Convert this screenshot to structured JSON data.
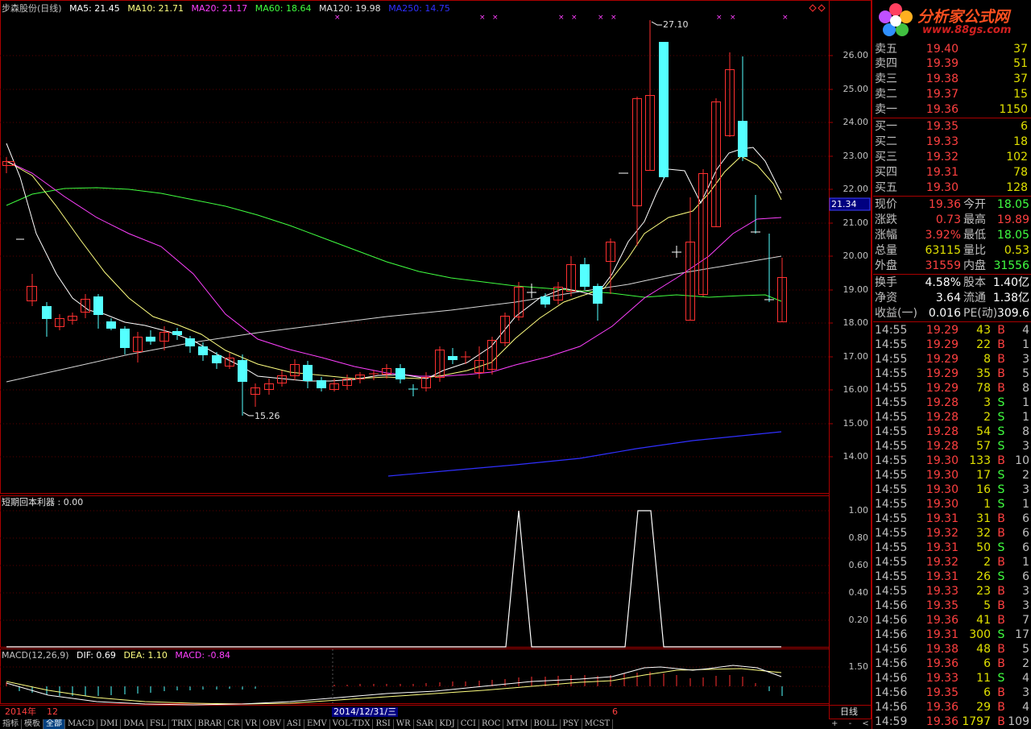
{
  "colors": {
    "up": "#ff3030",
    "down": "#54ffff",
    "ma5": "#ffffff",
    "ma10": "#ffff80",
    "ma20": "#ff40ff",
    "ma60": "#40ff40",
    "ma120": "#e0e0e0",
    "ma250": "#3030ff",
    "frame": "#aa0000"
  },
  "header": {
    "stock": "步森股份(日线)",
    "ma5": "MA5: 21.45",
    "ma10": "MA10: 21.71",
    "ma20": "MA20: 21.17",
    "ma60": "MA60: 18.64",
    "ma120": "MA120: 19.98",
    "ma250": "MA250: 14.75"
  },
  "price_axis": [
    "26.00",
    "25.00",
    "24.00",
    "23.00",
    "22.00",
    "21.00",
    "20.00",
    "19.00",
    "18.00",
    "17.00",
    "16.00",
    "15.00",
    "14.00"
  ],
  "current_price_tag": "21.34",
  "annotations": {
    "high": "27.10",
    "low": "15.26"
  },
  "indicator1": {
    "title": "短期回本利器 : 0.00",
    "axis": [
      "1.00",
      "0.80",
      "0.60",
      "0.40",
      "0.20"
    ]
  },
  "indicator2": {
    "title_a": "MACD(12,26,9)",
    "dif": "DIF: 0.69",
    "dea": "DEA: 1.10",
    "macd": "MACD: -0.84",
    "axis": [
      "1.50"
    ]
  },
  "date_axis": {
    "year": "2014年",
    "month1": "12",
    "cursor": "2014/12/31/三",
    "month2": "6",
    "period": "日线"
  },
  "toolbar": [
    "指标",
    "模板",
    "全部",
    "MACD",
    "DMI",
    "DMA",
    "FSL",
    "TRIX",
    "BRAR",
    "CR",
    "VR",
    "OBV",
    "ASI",
    "EMV",
    "VOL-TDX",
    "RSI",
    "WR",
    "SAR",
    "KDJ",
    "CCI",
    "ROC",
    "MTM",
    "BOLL",
    "PSY",
    "MCST"
  ],
  "toolbar_active": "全部",
  "scroll_btns": [
    "+",
    "-",
    "<",
    ">"
  ],
  "logo": {
    "text": "分析家公式网",
    "url": "www.88gs.com"
  },
  "sell": [
    {
      "label": "卖五",
      "price": "19.40",
      "vol": "37"
    },
    {
      "label": "卖四",
      "price": "19.39",
      "vol": "51"
    },
    {
      "label": "卖三",
      "price": "19.38",
      "vol": "37"
    },
    {
      "label": "卖二",
      "price": "19.37",
      "vol": "15"
    },
    {
      "label": "卖一",
      "price": "19.36",
      "vol": "1150"
    }
  ],
  "buy": [
    {
      "label": "买一",
      "price": "19.35",
      "vol": "6"
    },
    {
      "label": "买二",
      "price": "19.33",
      "vol": "18"
    },
    {
      "label": "买三",
      "price": "19.32",
      "vol": "102"
    },
    {
      "label": "买四",
      "price": "19.31",
      "vol": "78"
    },
    {
      "label": "买五",
      "price": "19.30",
      "vol": "128"
    }
  ],
  "quote": [
    {
      "k1": "现价",
      "v1": "19.36",
      "c1": "red",
      "k2": "今开",
      "v2": "18.05",
      "c2": "green"
    },
    {
      "k1": "涨跌",
      "v1": "0.73",
      "c1": "red",
      "k2": "最高",
      "v2": "19.89",
      "c2": "red"
    },
    {
      "k1": "涨幅",
      "v1": "3.92%",
      "c1": "red",
      "k2": "最低",
      "v2": "18.05",
      "c2": "green"
    },
    {
      "k1": "总量",
      "v1": "63115",
      "c1": "yellow",
      "k2": "量比",
      "v2": "0.53",
      "c2": "yellow"
    },
    {
      "k1": "外盘",
      "v1": "31559",
      "c1": "red",
      "k2": "内盘",
      "v2": "31556",
      "c2": "green"
    }
  ],
  "fund": [
    {
      "k1": "换手",
      "v1": "4.58%",
      "k2": "股本",
      "v2": "1.40亿"
    },
    {
      "k1": "净资",
      "v1": "3.64",
      "k2": "流通",
      "v2": "1.38亿"
    },
    {
      "k1": "收益(一)",
      "v1": "0.016",
      "k2": "PE(动)",
      "v2": "309.6"
    }
  ],
  "ticks": [
    {
      "t": "14:55",
      "p": "19.29",
      "v": "43",
      "d": "B",
      "n": "4"
    },
    {
      "t": "14:55",
      "p": "19.29",
      "v": "22",
      "d": "B",
      "n": "1"
    },
    {
      "t": "14:55",
      "p": "19.29",
      "v": "8",
      "d": "B",
      "n": "3"
    },
    {
      "t": "14:55",
      "p": "19.29",
      "v": "35",
      "d": "B",
      "n": "5"
    },
    {
      "t": "14:55",
      "p": "19.29",
      "v": "78",
      "d": "B",
      "n": "8"
    },
    {
      "t": "14:55",
      "p": "19.28",
      "v": "3",
      "d": "S",
      "n": "1"
    },
    {
      "t": "14:55",
      "p": "19.28",
      "v": "2",
      "d": "S",
      "n": "1"
    },
    {
      "t": "14:55",
      "p": "19.28",
      "v": "54",
      "d": "S",
      "n": "8"
    },
    {
      "t": "14:55",
      "p": "19.28",
      "v": "57",
      "d": "S",
      "n": "3"
    },
    {
      "t": "14:55",
      "p": "19.30",
      "v": "133",
      "d": "B",
      "n": "10"
    },
    {
      "t": "14:55",
      "p": "19.30",
      "v": "17",
      "d": "S",
      "n": "2"
    },
    {
      "t": "14:55",
      "p": "19.30",
      "v": "16",
      "d": "S",
      "n": "3"
    },
    {
      "t": "14:55",
      "p": "19.30",
      "v": "1",
      "d": "S",
      "n": "1"
    },
    {
      "t": "14:55",
      "p": "19.31",
      "v": "31",
      "d": "B",
      "n": "6"
    },
    {
      "t": "14:55",
      "p": "19.32",
      "v": "32",
      "d": "B",
      "n": "6"
    },
    {
      "t": "14:55",
      "p": "19.31",
      "v": "50",
      "d": "S",
      "n": "6"
    },
    {
      "t": "14:55",
      "p": "19.32",
      "v": "2",
      "d": "B",
      "n": "1"
    },
    {
      "t": "14:55",
      "p": "19.31",
      "v": "26",
      "d": "S",
      "n": "6"
    },
    {
      "t": "14:55",
      "p": "19.33",
      "v": "23",
      "d": "B",
      "n": "3"
    },
    {
      "t": "14:56",
      "p": "19.35",
      "v": "5",
      "d": "B",
      "n": "3"
    },
    {
      "t": "14:56",
      "p": "19.36",
      "v": "41",
      "d": "B",
      "n": "7"
    },
    {
      "t": "14:56",
      "p": "19.31",
      "v": "300",
      "d": "S",
      "n": "17"
    },
    {
      "t": "14:56",
      "p": "19.38",
      "v": "48",
      "d": "B",
      "n": "5"
    },
    {
      "t": "14:56",
      "p": "19.36",
      "v": "6",
      "d": "B",
      "n": "2"
    },
    {
      "t": "14:56",
      "p": "19.33",
      "v": "11",
      "d": "S",
      "n": "4"
    },
    {
      "t": "14:56",
      "p": "19.35",
      "v": "6",
      "d": "B",
      "n": "3"
    },
    {
      "t": "14:56",
      "p": "19.36",
      "v": "29",
      "d": "B",
      "n": "4"
    },
    {
      "t": "14:59",
      "p": "19.36",
      "v": "1797",
      "d": "B",
      "n": "109"
    }
  ]
}
